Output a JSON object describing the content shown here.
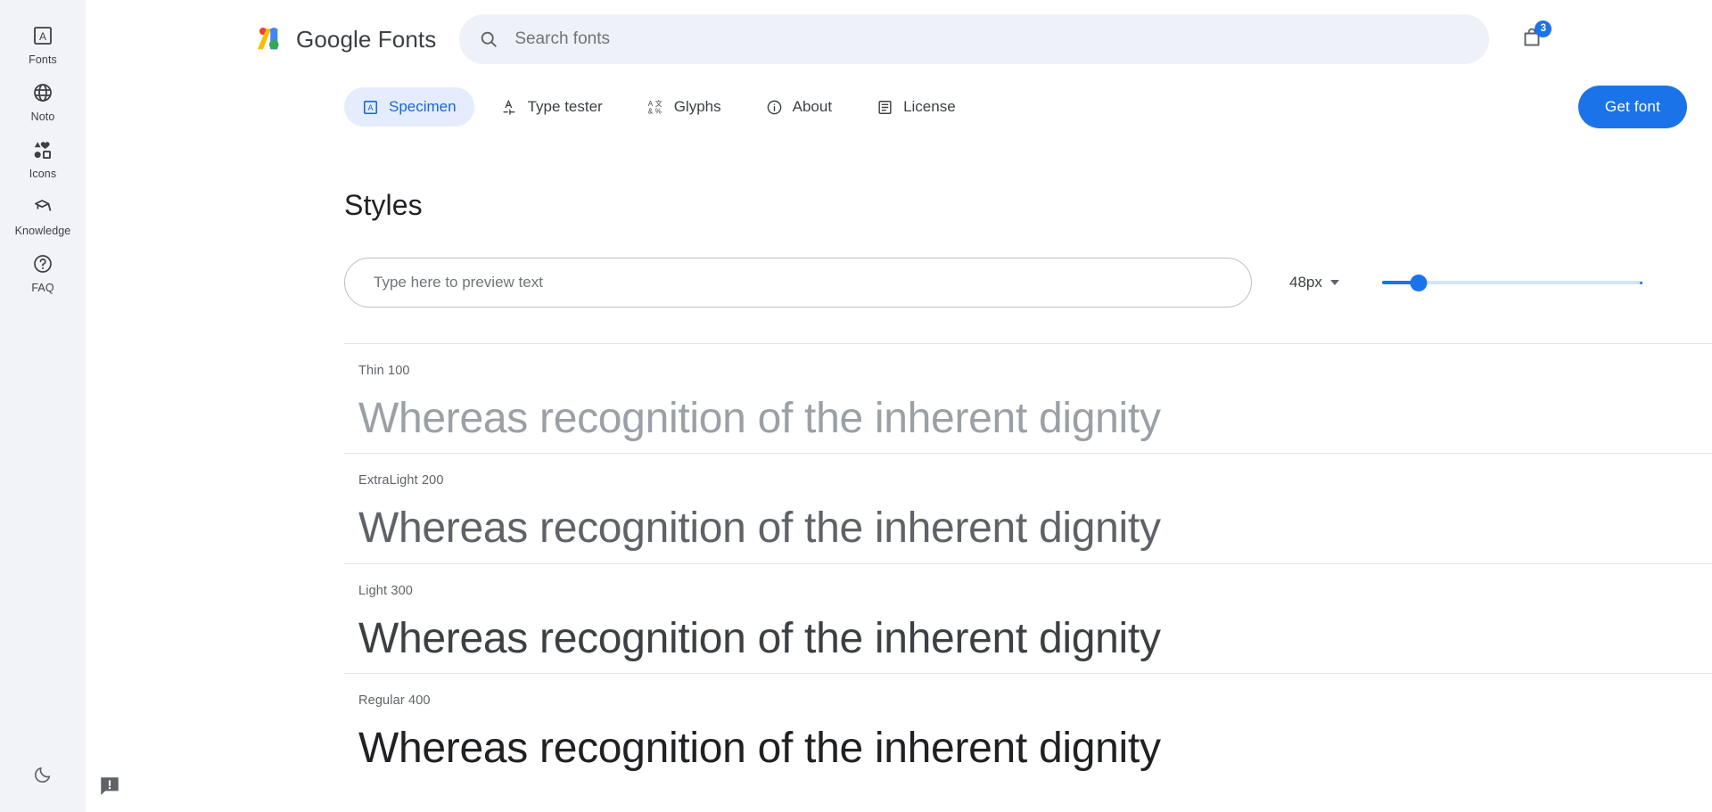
{
  "sidebar": {
    "items": [
      {
        "label": "Fonts",
        "icon": "font-square-icon"
      },
      {
        "label": "Noto",
        "icon": "globe-icon"
      },
      {
        "label": "Icons",
        "icon": "shapes-icon"
      },
      {
        "label": "Knowledge",
        "icon": "graduation-cap-icon"
      },
      {
        "label": "FAQ",
        "icon": "help-circle-icon"
      }
    ],
    "dark_mode_icon": "moon-icon"
  },
  "header": {
    "brand_google": "Google",
    "brand_fonts": "Fonts",
    "logo_icon": "google-fonts-logo",
    "search": {
      "placeholder": "Search fonts",
      "value": "",
      "icon": "search-icon"
    },
    "cart": {
      "icon": "shopping-bag-icon",
      "badge": "3"
    }
  },
  "tabs": [
    {
      "label": "Specimen",
      "icon": "specimen-icon",
      "active": true
    },
    {
      "label": "Type tester",
      "icon": "type-tester-icon",
      "active": false
    },
    {
      "label": "Glyphs",
      "icon": "glyphs-icon",
      "active": false
    },
    {
      "label": "About",
      "icon": "info-circle-icon",
      "active": false
    },
    {
      "label": "License",
      "icon": "license-icon",
      "active": false
    }
  ],
  "actions": {
    "get_font_label": "Get font"
  },
  "styles_section": {
    "title": "Styles",
    "preview": {
      "placeholder": "Type here to preview text",
      "value": ""
    },
    "size": {
      "value": "48px",
      "slider_percent": 14,
      "caret_icon": "chevron-down-icon"
    },
    "rows": [
      {
        "label": "Thin 100",
        "sample": "Whereas recognition of the inherent dignity",
        "weight_class": "w100"
      },
      {
        "label": "ExtraLight 200",
        "sample": "Whereas recognition of the inherent dignity",
        "weight_class": "w200"
      },
      {
        "label": "Light 300",
        "sample": "Whereas recognition of the inherent dignity",
        "weight_class": "w300"
      },
      {
        "label": "Regular 400",
        "sample": "Whereas recognition of the inherent dignity",
        "weight_class": "w400"
      }
    ]
  },
  "feedback": {
    "icon": "feedback-icon"
  },
  "colors": {
    "accent_blue": "#1a73e8",
    "tab_active_bg": "#e4ecfd",
    "tab_active_fg": "#1967d2",
    "rail_bg": "#f1f3f9",
    "search_bg": "#eef1f8"
  }
}
